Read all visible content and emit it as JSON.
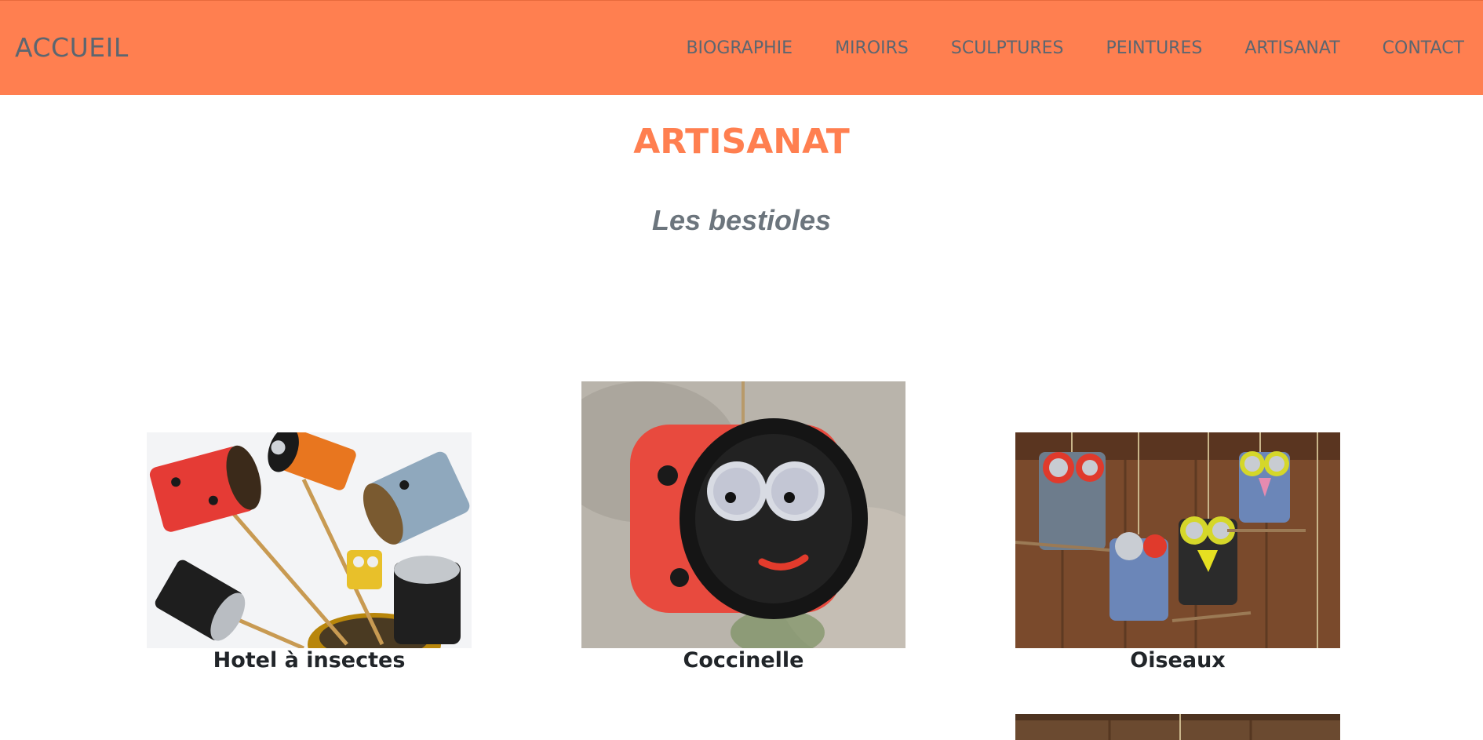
{
  "header": {
    "brand": "ACCUEIL",
    "nav": [
      "BIOGRAPHIE",
      "MIROIRS",
      "SCULPTURES",
      "PEINTURES",
      "ARTISANAT",
      "CONTACT"
    ]
  },
  "main": {
    "title": "ARTISANAT",
    "subtitle": "Les bestioles",
    "cards": [
      {
        "caption": "Hotel à insectes"
      },
      {
        "caption": "Coccinelle"
      },
      {
        "caption": "Oiseaux"
      }
    ]
  },
  "colors": {
    "accent": "#ff7f50",
    "nav_text": "#5c6670",
    "subtitle": "#6c757d"
  }
}
